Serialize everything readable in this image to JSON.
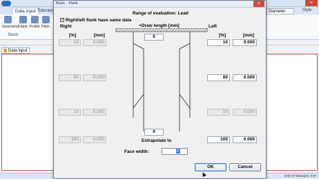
{
  "app": {
    "ribbon_tabs": [
      "Data input",
      "Tolerance"
    ],
    "ribbon_buttons": [
      "Geometry",
      "Flank",
      "Profile",
      "Pitch"
    ],
    "group_label": "Basic",
    "diameter_combo": "Diameter",
    "style_label": "Style",
    "doc_tab": "Data input",
    "status_right": "Unit of measure: mm"
  },
  "dialog": {
    "title": "Basic - Flank",
    "close_glyph": "×",
    "range_title": "Range of evaluation: Lead",
    "same_data_checkbox": {
      "checked": true,
      "glyph": "✓",
      "label": "Right/left flank have same data"
    },
    "right_label": "Right",
    "left_label": "Left",
    "col_percent": "[%]",
    "col_mm": "[mm]",
    "right_rows": [
      {
        "percent": "10",
        "mm": "0.000"
      },
      {
        "percent": "80",
        "mm": "0.000"
      },
      {
        "percent": "10",
        "mm": "0.000"
      },
      {
        "percent": "100",
        "mm": "0.000"
      }
    ],
    "left_rows": [
      {
        "percent": "10",
        "mm": "0.000"
      },
      {
        "percent": "80",
        "mm": "0.000"
      },
      {
        "percent": "10",
        "mm": "0.000"
      },
      {
        "percent": "100",
        "mm": "0.000"
      }
    ],
    "draw_length_label": "+Draw length [mm]",
    "top_value": "0",
    "bottom_value": "0",
    "extrapolate_label": "Extrapolate to",
    "face_width_label": "Face width:",
    "face_width_value": "0",
    "ok_label": "OK",
    "cancel_label": "Cancel"
  },
  "colors": {
    "accent": "#3a7bd5",
    "close_red": "#c94a3c",
    "ribbon_bg": "#dbe5f1"
  }
}
